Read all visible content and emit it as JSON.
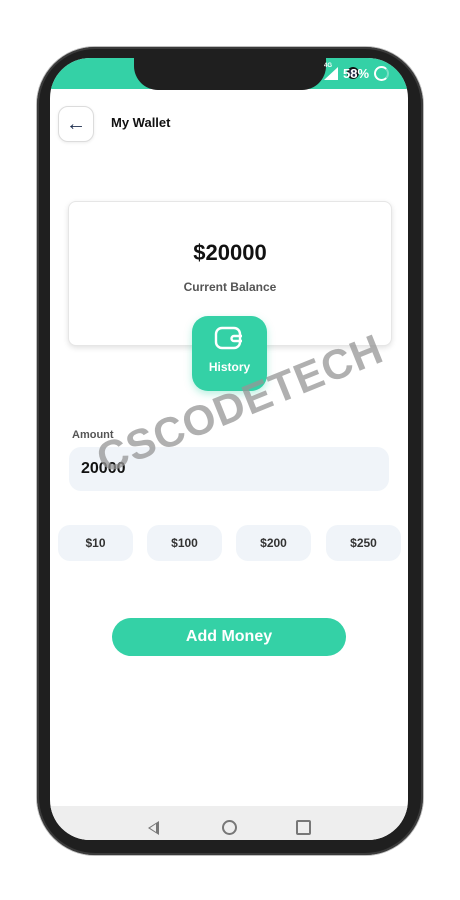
{
  "status_bar": {
    "network": "4G",
    "battery": "58%"
  },
  "header": {
    "title": "My Wallet"
  },
  "balance": {
    "amount": "$20000",
    "label": "Current Balance"
  },
  "history": {
    "label": "History"
  },
  "amount_input": {
    "label": "Amount",
    "value": "20000"
  },
  "quick_amounts": [
    "$10",
    "$100",
    "$200",
    "$250"
  ],
  "actions": {
    "add_money": "Add Money"
  },
  "watermark": {
    "text": "CSCODETECH"
  },
  "colors": {
    "accent": "#34d1a6",
    "field_bg": "#f0f4f9"
  }
}
